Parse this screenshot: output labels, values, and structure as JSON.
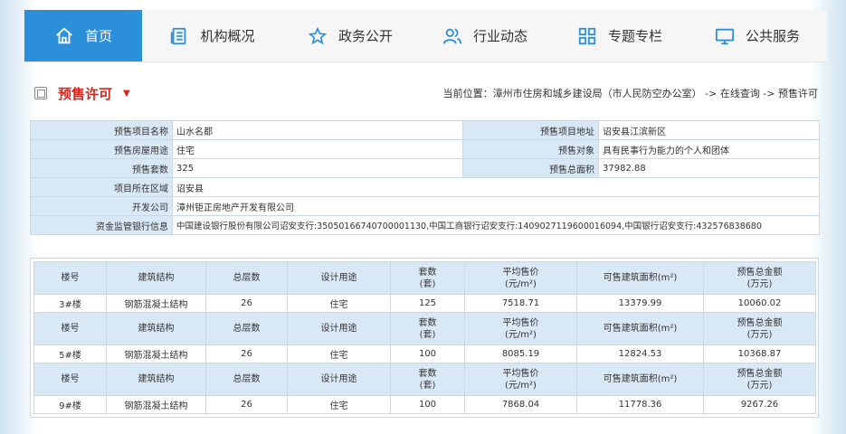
{
  "nav": {
    "items": [
      {
        "label": "首页",
        "icon": "home-icon"
      },
      {
        "label": "机构概况",
        "icon": "document-list-icon"
      },
      {
        "label": "政务公开",
        "icon": "star-icon"
      },
      {
        "label": "行业动态",
        "icon": "users-icon"
      },
      {
        "label": "专题专栏",
        "icon": "grid-icon"
      },
      {
        "label": "公共服务",
        "icon": "monitor-icon"
      }
    ],
    "active_color": "#2b90d9"
  },
  "page": {
    "title": "预售许可",
    "breadcrumb": "当前位置：漳州市住房和城乡建设局（市人民防空办公室） -> 在线查询 -> 预售许可"
  },
  "info": {
    "project_name_label": "预售项目名称",
    "project_name": "山水名都",
    "project_address_label": "预售项目地址",
    "project_address": "诏安县江滨新区",
    "usage_label": "预售房屋用途",
    "usage": "住宅",
    "target_label": "预售对象",
    "target": "具有民事行为能力的个人和团体",
    "count_label": "预售套数",
    "count": "325",
    "area_label": "预售总面积",
    "area": "37982.88",
    "region_label": "项目所在区域",
    "region": "诏安县",
    "developer_label": "开发公司",
    "developer": "漳州钜正房地产开发有限公司",
    "bank_label": "资金监管银行信息",
    "bank": "中国建设银行股份有限公司诏安支行:35050166740700001130,中国工商银行诏安支行:1409027119600016094,中国银行诏安支行:432576838680"
  },
  "building_headers": {
    "number": "楼号",
    "structure": "建筑结构",
    "floors": "总层数",
    "design_use": "设计用途",
    "units_line1": "套数",
    "units_line2": "(套)",
    "avg_price_line1": "平均售价",
    "avg_price_line2": "(元/m²)",
    "sale_area": "可售建筑面积(m²)",
    "total_line1": "预售总金额",
    "total_line2": "(万元)"
  },
  "buildings": [
    {
      "number": "3#楼",
      "structure": "钢筋混凝土结构",
      "floors": "26",
      "design_use": "住宅",
      "units": "125",
      "avg_price": "7518.71",
      "sale_area": "13379.99",
      "total": "10060.02"
    },
    {
      "number": "5#楼",
      "structure": "钢筋混凝土结构",
      "floors": "26",
      "design_use": "住宅",
      "units": "100",
      "avg_price": "8085.19",
      "sale_area": "12824.53",
      "total": "10368.87"
    },
    {
      "number": "9#楼",
      "structure": "钢筋混凝土结构",
      "floors": "26",
      "design_use": "住宅",
      "units": "100",
      "avg_price": "7868.04",
      "sale_area": "11778.36",
      "total": "9267.26"
    }
  ]
}
